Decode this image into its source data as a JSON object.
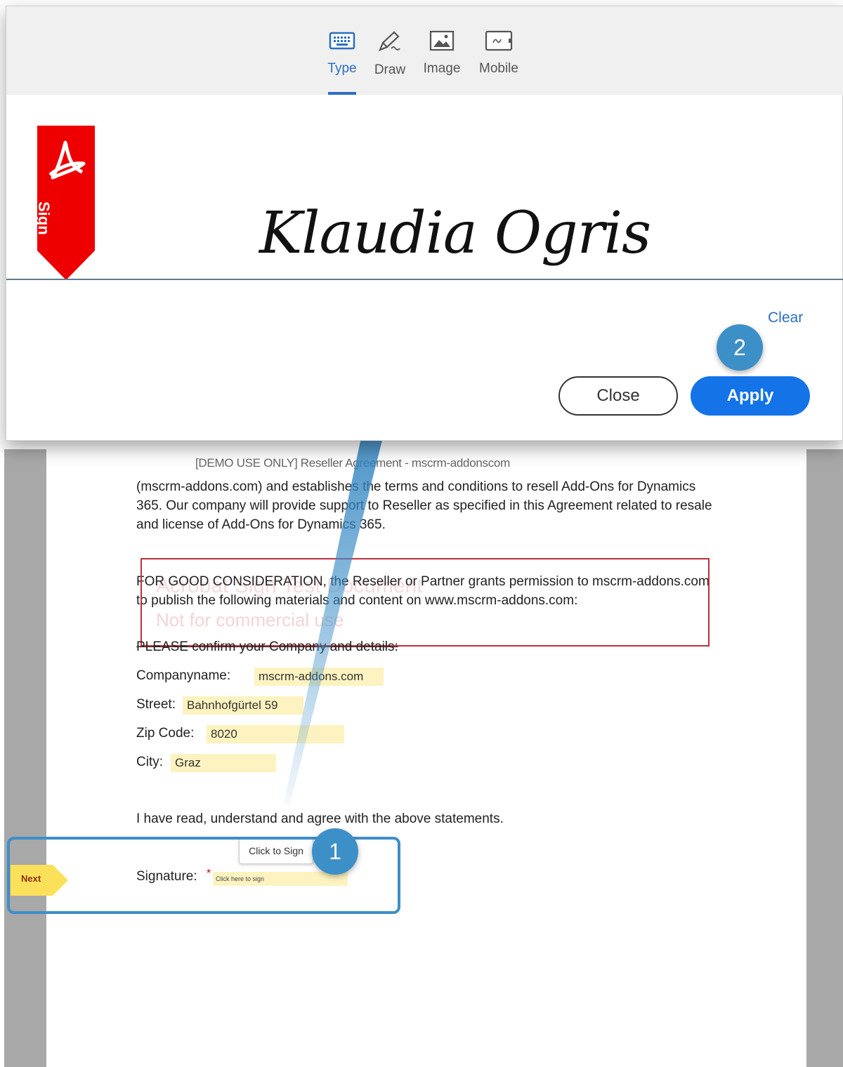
{
  "dialog": {
    "tabs": [
      {
        "label": "Type",
        "icon": "keyboard-icon"
      },
      {
        "label": "Draw",
        "icon": "pen-icon"
      },
      {
        "label": "Image",
        "icon": "image-icon"
      },
      {
        "label": "Mobile",
        "icon": "mobile-icon"
      }
    ],
    "active_tab": "Type",
    "ribbon_label": "Sign",
    "signature": "Klaudia Ogris",
    "clear_label": "Clear",
    "close_label": "Close",
    "apply_label": "Apply",
    "accent_color": "#1473e6"
  },
  "document": {
    "header": "[DEMO USE ONLY] Reseller Agreement - mscrm-addonscom",
    "para1": "(mscrm-addons.com) and establishes the terms and conditions to resell Add-Ons for Dynamics 365. Our company will provide support to Reseller as specified in this Agreement related to resale and license of Add-Ons for Dynamics 365.",
    "para2": "FOR GOOD CONSIDERATION, the Reseller or Partner grants permission to mscrm-addons.com to publish the following materials and content on www.mscrm-addons.com:",
    "watermark_line1": "Acrobat Sign Test Document",
    "watermark_line2": "Not for commercial use",
    "para3": "PLEASE confirm your Company and details:",
    "fields": {
      "company_label": "Companyname:",
      "company_value": "mscrm-addons.com",
      "street_label": "Street:",
      "street_value": "Bahnhofgürtel 59",
      "zip_label": "Zip Code:",
      "zip_value": "8020",
      "city_label": "City:",
      "city_value": "Graz"
    },
    "agree_text": "I have read, understand and agree with the above statements.",
    "signature_label": "Signature:",
    "required_marker": "*",
    "signature_field_placeholder": "Click here to sign",
    "tooltip": "Click to Sign",
    "next_label": "Next"
  },
  "annotations": {
    "badge1": "1",
    "badge2": "2",
    "callout_color": "#3d8fc8"
  }
}
